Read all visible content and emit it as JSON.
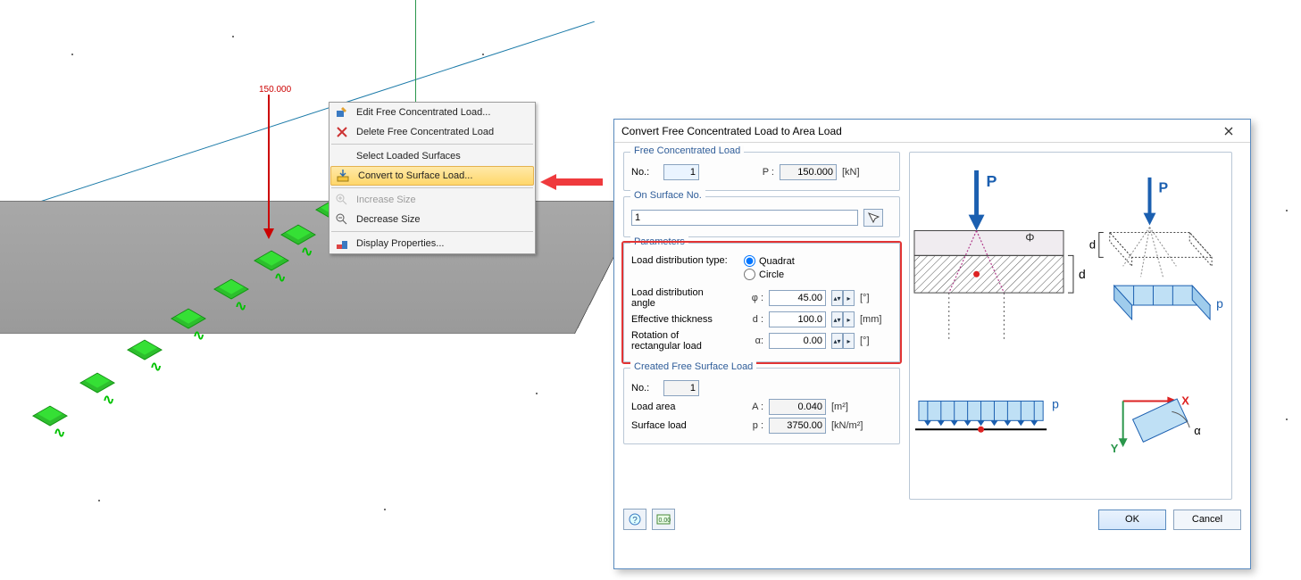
{
  "viewport": {
    "load_value_label": "150.000"
  },
  "context_menu": {
    "edit": "Edit Free Concentrated Load...",
    "delete": "Delete Free Concentrated Load",
    "select_surfaces": "Select Loaded Surfaces",
    "convert": "Convert to Surface Load...",
    "increase": "Increase Size",
    "decrease": "Decrease Size",
    "display_props": "Display Properties..."
  },
  "dialog": {
    "title": "Convert Free Concentrated Load to Area Load",
    "groups": {
      "free_load": {
        "legend": "Free Concentrated Load",
        "no_label": "No.:",
        "no_value": "1",
        "p_label": "P :",
        "p_value": "150.000",
        "p_unit": "[kN]"
      },
      "on_surface": {
        "legend": "On Surface No.",
        "value": "1"
      },
      "parameters": {
        "legend": "Parameters",
        "dist_type_label": "Load distribution type:",
        "opt_quadrat": "Quadrat",
        "opt_circle": "Circle",
        "angle_label": "Load distribution\nangle",
        "angle_sym": "φ :",
        "angle_value": "45.00",
        "angle_unit": "[°]",
        "thick_label": "Effective thickness",
        "thick_sym": "d :",
        "thick_value": "100.0",
        "thick_unit": "[mm]",
        "rot_label": "Rotation of\nrectangular load",
        "rot_sym": "α:",
        "rot_value": "0.00",
        "rot_unit": "[°]"
      },
      "created": {
        "legend": "Created Free Surface Load",
        "no_label": "No.:",
        "no_value": "1",
        "area_label": "Load area",
        "area_sym": "A :",
        "area_value": "0.040",
        "area_unit": "[m²]",
        "surf_label": "Surface load",
        "surf_sym": "p :",
        "surf_value": "3750.00",
        "surf_unit": "[kN/m²]"
      }
    },
    "buttons": {
      "ok": "OK",
      "cancel": "Cancel"
    },
    "diagram_labels": {
      "P1": "P",
      "P2": "P",
      "phi": "Φ",
      "d1": "d",
      "d2": "d",
      "p_small1": "p",
      "p_small2": "p",
      "X": "X",
      "Y": "Y",
      "alpha": "α"
    }
  }
}
